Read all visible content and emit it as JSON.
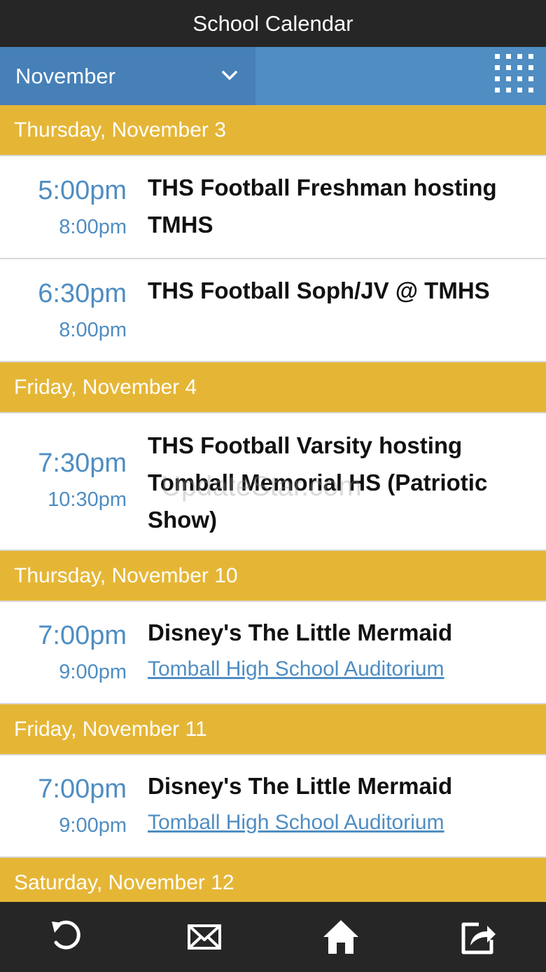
{
  "header": {
    "title": "School Calendar"
  },
  "month_bar": {
    "selected_month": "November"
  },
  "days": [
    {
      "label": "Thursday, November 3",
      "events": [
        {
          "start": "5:00pm",
          "end": "8:00pm",
          "title": "THS Football Freshman hosting TMHS",
          "location": ""
        },
        {
          "start": "6:30pm",
          "end": "8:00pm",
          "title": "THS Football Soph/JV @ TMHS",
          "location": ""
        }
      ]
    },
    {
      "label": "Friday, November 4",
      "events": [
        {
          "start": "7:30pm",
          "end": "10:30pm",
          "title": "THS Football Varsity hosting Tomball Memorial HS (Patriotic Show)",
          "location": ""
        }
      ]
    },
    {
      "label": "Thursday, November 10",
      "events": [
        {
          "start": "7:00pm",
          "end": "9:00pm",
          "title": "Disney's The Little Mermaid",
          "location": "Tomball High School Auditorium"
        }
      ]
    },
    {
      "label": "Friday, November 11",
      "events": [
        {
          "start": "7:00pm",
          "end": "9:00pm",
          "title": "Disney's The Little Mermaid",
          "location": "Tomball High School Auditorium"
        }
      ]
    },
    {
      "label": "Saturday, November 12",
      "events": []
    }
  ],
  "watermark": "UpdateStar.com",
  "bottom_nav": [
    {
      "icon": "refresh-icon"
    },
    {
      "icon": "mail-icon"
    },
    {
      "icon": "home-icon"
    },
    {
      "icon": "share-icon"
    }
  ],
  "colors": {
    "title_bar": "#262626",
    "month_bar": "#4f8dc2",
    "day_header": "#e5b636",
    "time_text": "#4f8dc2"
  }
}
